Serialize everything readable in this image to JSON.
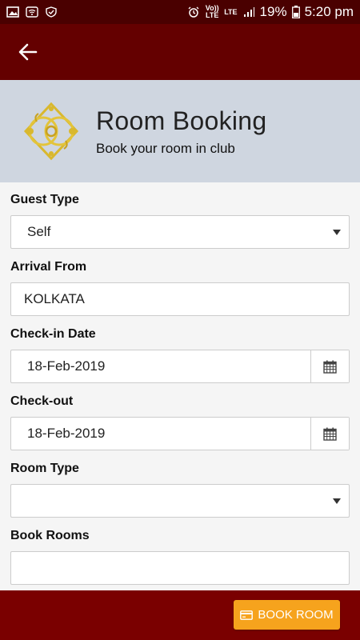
{
  "status_bar": {
    "network_label_1": "Vo)) LTE",
    "network_label_2": "LTE",
    "battery": "19%",
    "time": "5:20 pm"
  },
  "app_bar": {
    "back_icon": "arrow-left"
  },
  "header": {
    "title": "Room Booking",
    "subtitle": "Book your room in club"
  },
  "form": {
    "guest_type": {
      "label": "Guest Type",
      "value": "Self"
    },
    "arrival_from": {
      "label": "Arrival From",
      "value": "KOLKATA"
    },
    "check_in": {
      "label": "Check-in Date",
      "value": "18-Feb-2019"
    },
    "check_out": {
      "label": "Check-out",
      "value": "18-Feb-2019"
    },
    "room_type": {
      "label": "Room Type",
      "value": ""
    },
    "book_rooms": {
      "label": "Book Rooms",
      "value": ""
    }
  },
  "footer": {
    "book_button_label": "BOOK ROOM",
    "book_button_icon": "credit-card"
  },
  "colors": {
    "status_bar": "#4a0000",
    "app_bar": "#640000",
    "header_bg": "#cfd6e0",
    "footer": "#7a0000",
    "accent_button": "#f6a31d"
  }
}
